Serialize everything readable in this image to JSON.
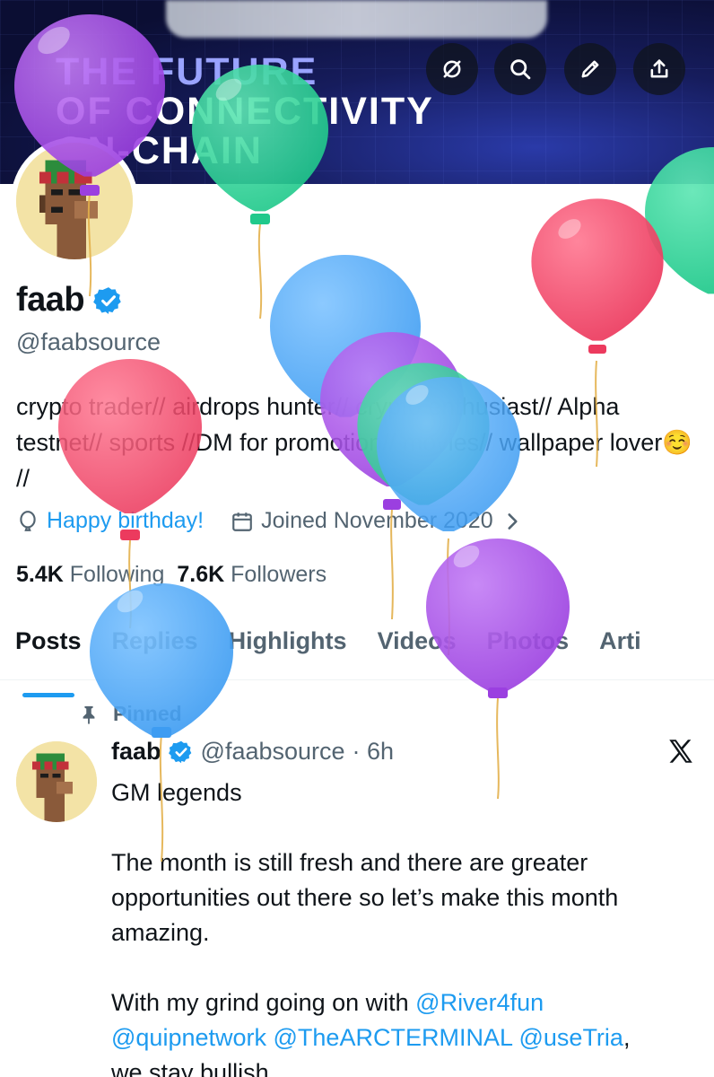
{
  "banner": {
    "lines": [
      "THE FUTURE",
      "OF CONNECTIVITY",
      "ON-CHAIN"
    ]
  },
  "toolbar": {
    "icons": [
      "grok-icon",
      "search-icon",
      "edit-icon",
      "share-icon"
    ]
  },
  "profile": {
    "name": "faab",
    "handle": "@faabsource",
    "bio": "crypto trader// airdrops hunter// crypto enthusiast// Alpha testnet// sports //DM for promotion// movies// wallpaper lover☺️ //",
    "birthday": "Happy birthday!",
    "joined": "Joined November 2020",
    "following_count": "5.4K",
    "following_label": "Following",
    "followers_count": "7.6K",
    "followers_label": "Followers"
  },
  "tabs": [
    "Posts",
    "Replies",
    "Highlights",
    "Videos",
    "Photos",
    "Arti"
  ],
  "post": {
    "pinned_label": "Pinned",
    "author": "faab",
    "handle": "@faabsource",
    "time": "· 6h",
    "line1": "GM legends",
    "para2": "The month is still fresh and there are greater opportunities out there so let’s make this month amazing.",
    "para3_prefix": "With my grind going on with ",
    "mentions": [
      "@River4fun",
      "@quipnetwork",
      "@TheARCTERMINAL",
      "@useTria"
    ],
    "para3_suffix": ",",
    "last_line": "we stay bullish"
  },
  "colors": {
    "accent": "#1d9bf0",
    "text": "#0f1419",
    "muted": "#536471",
    "balloon_purple": "#a449e6",
    "balloon_green": "#2fd59a",
    "balloon_blue": "#48a6f5",
    "balloon_red": "#f2476a"
  }
}
